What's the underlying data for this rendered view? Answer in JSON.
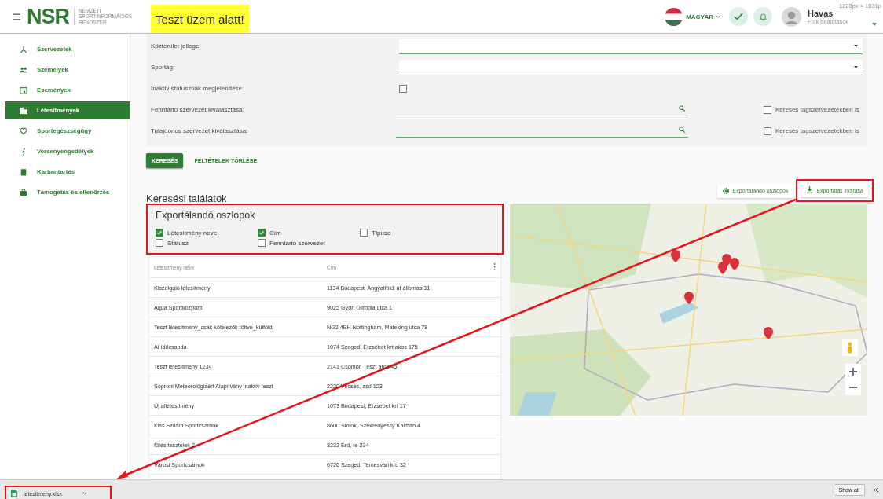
{
  "header": {
    "logo": "NSR",
    "tagline": "NEMZETI SPORTINFORMÁCIÓS RENDSZER",
    "banner": "Teszt üzem alatt!",
    "language": "MAGYAR",
    "user_name": "Havas",
    "account_link": "Fiók beállítások",
    "size_label": "1820px × 1031p"
  },
  "sidebar": {
    "items": [
      {
        "label": "Szervezetek",
        "selected": false
      },
      {
        "label": "Személyek",
        "selected": false
      },
      {
        "label": "Események",
        "selected": false
      },
      {
        "label": "Létesítmények",
        "selected": true
      },
      {
        "label": "Sportegészségügy",
        "selected": false
      },
      {
        "label": "Versenyengedélyek",
        "selected": false
      },
      {
        "label": "Karbantartás",
        "selected": false
      },
      {
        "label": "Támogatás és ellenőrzés",
        "selected": false
      }
    ]
  },
  "filters": [
    {
      "kind": "select",
      "label": "Közterület jellege:"
    },
    {
      "kind": "select",
      "label": "Sportág:"
    },
    {
      "kind": "checkbox",
      "label": "Inaktív státuszúak megjelenítése:",
      "checked": false
    },
    {
      "kind": "search",
      "label": "Fenntartó szervezet kiválasztása:",
      "member_search": {
        "label": "Keresés tagszervezetekben is",
        "checked": false
      }
    },
    {
      "kind": "search",
      "label": "Tulajdonos szervezet kiválasztása:",
      "member_search": {
        "label": "Keresés tagszervezetekben is",
        "checked": false
      }
    }
  ],
  "actions": [
    "KERESÉS",
    "FELTÉTELEK TÖRLÉSE"
  ],
  "results": {
    "title": "Keresési találatok",
    "toolbar": [
      "Exportálandó oszlopok",
      "Exportálás indítása"
    ],
    "export_panel": {
      "title": "Exportálandó oszlopok",
      "columns": [
        {
          "label": "Létesítmény neve",
          "checked": true
        },
        {
          "label": "Cím",
          "checked": true
        },
        {
          "label": "Típusa",
          "checked": false
        },
        {
          "label": "Státusz",
          "checked": false
        },
        {
          "label": "Fenntartó szervezet",
          "checked": false
        }
      ]
    },
    "table": {
      "columns": [
        "Létesítmény neve",
        "Cím"
      ],
      "rows": [
        [
          "Kiszolgáló létesítmény",
          "1134 Budapest, Angyalföldi út állomás 31"
        ],
        [
          "Aqua Sportközpont",
          "9025 Győr, Olimpia utca 1"
        ],
        [
          "Teszt létesítmény_csak kötelezők töltve_külföldi",
          "NG2 4BH Nottingham, Mafeking utca 78"
        ],
        [
          "AI időcsapda",
          "1074 Szeged, Erzsébet krt akos 175"
        ],
        [
          "Teszt létesítmény 1234",
          "2141 Csömör, Teszt árok 45"
        ],
        [
          "Soproni Meteorológiáért Alapítvány inaktív teszt",
          "2220 Vecsés, asd 123"
        ],
        [
          "Új allétesítmény",
          "1073 Budapest, Erzsébet krt 17"
        ],
        [
          "Kiss Szilárd Sportcsarnok",
          "8600 Siófok, Szekrényessy Kálmán 4"
        ],
        [
          "fűtés tesztelek 2",
          "3232 Érd, re 234"
        ],
        [
          "Városi Sportcsarnok",
          "6726 Szeged, Temesvári krt. 32"
        ]
      ]
    }
  },
  "download_bar": {
    "file": "letesitmeny.xlsx",
    "show_all": "Show all"
  }
}
